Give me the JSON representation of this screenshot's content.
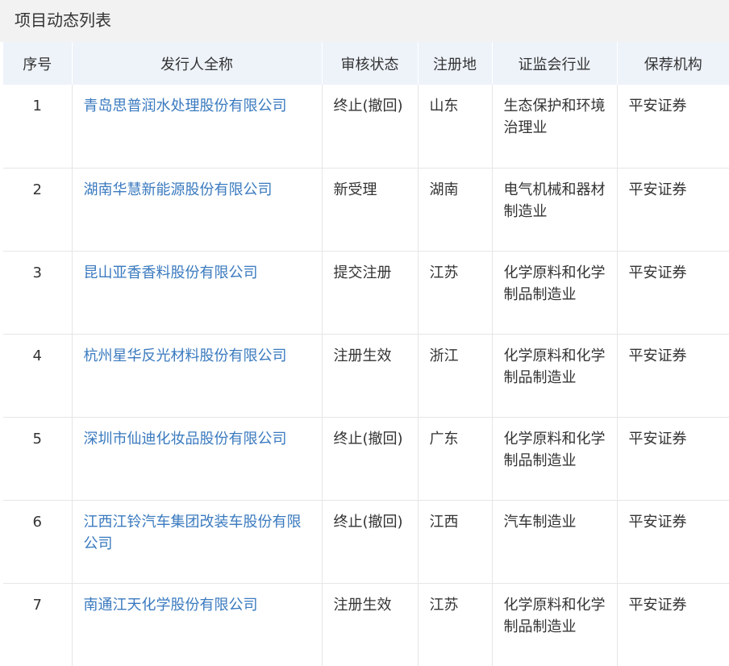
{
  "panel": {
    "title": "项目动态列表"
  },
  "table": {
    "columns": [
      "序号",
      "发行人全称",
      "审核状态",
      "注册地",
      "证监会行业",
      "保荐机构"
    ],
    "rows": [
      [
        "1",
        "青岛思普润水处理股份有限公司",
        "终止(撤回)",
        "山东",
        "生态保护和环境治理业",
        "平安证券"
      ],
      [
        "2",
        "湖南华慧新能源股份有限公司",
        "新受理",
        "湖南",
        "电气机械和器材制造业",
        "平安证券"
      ],
      [
        "3",
        "昆山亚香香料股份有限公司",
        "提交注册",
        "江苏",
        "化学原料和化学制品制造业",
        "平安证券"
      ],
      [
        "4",
        "杭州星华反光材料股份有限公司",
        "注册生效",
        "浙江",
        "化学原料和化学制品制造业",
        "平安证券"
      ],
      [
        "5",
        "深圳市仙迪化妆品股份有限公司",
        "终止(撤回)",
        "广东",
        "化学原料和化学制品制造业",
        "平安证券"
      ],
      [
        "6",
        "江西江铃汽车集团改装车股份有限公司",
        "终止(撤回)",
        "江西",
        "汽车制造业",
        "平安证券"
      ],
      [
        "7",
        "南通江天化学股份有限公司",
        "注册生效",
        "江苏",
        "化学原料和化学制品制造业",
        "平安证券"
      ]
    ]
  },
  "colors": {
    "title_bg": "#f2f2f2",
    "header_bg": "#eef3fa",
    "link": "#3a7abf",
    "text": "#333333",
    "border": "#e6e6e6"
  }
}
